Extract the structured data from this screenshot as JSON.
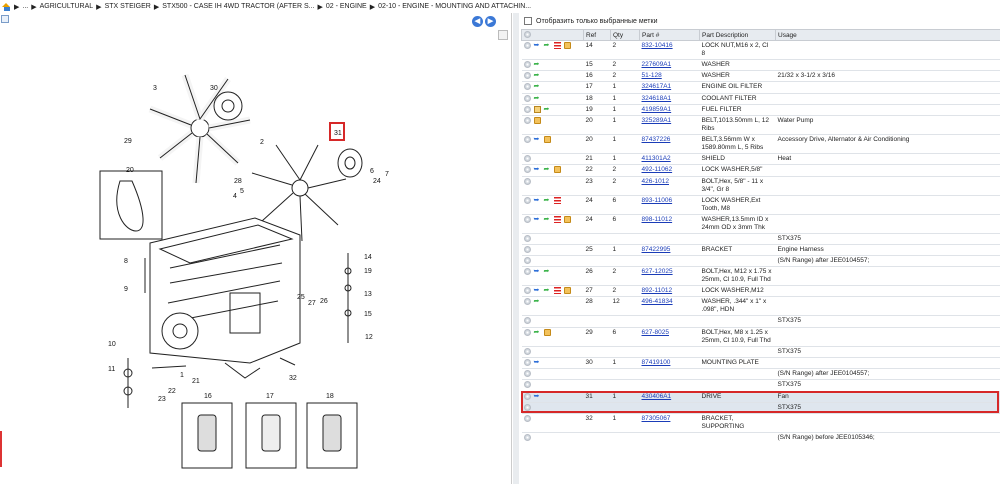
{
  "breadcrumb": {
    "items": [
      "...",
      "AGRICULTURAL",
      "STX STEIGER",
      "STX500 - CASE IH 4WD TRACTOR (AFTER S...",
      "02 - ENGINE",
      "02-10 - ENGINE - MOUNTING AND ATTACHIN..."
    ]
  },
  "filter": {
    "label": "Отобразить только выбранные метки"
  },
  "table": {
    "headers": [
      "Ref",
      "Qty",
      "Part #",
      "Part Description",
      "Usage"
    ],
    "rows": [
      {
        "icons": [
          "cart",
          "arrow",
          "bars",
          "box"
        ],
        "ref": "14",
        "qty": "2",
        "part": "832-10416",
        "desc": "LOCK NUT,M16 x 2, Cl 8",
        "usage": ""
      },
      {
        "icons": [
          "arrow"
        ],
        "ref": "15",
        "qty": "2",
        "part": "227609A1",
        "desc": "WASHER",
        "usage": ""
      },
      {
        "icons": [
          "arrow"
        ],
        "ref": "16",
        "qty": "2",
        "part": "51-128",
        "desc": "WASHER",
        "usage": "21/32 x 3-1/2 x 3/16"
      },
      {
        "icons": [
          "arrow"
        ],
        "ref": "17",
        "qty": "1",
        "part": "324617A1",
        "desc": "ENGINE OIL FILTER",
        "usage": ""
      },
      {
        "icons": [
          "arrow"
        ],
        "ref": "18",
        "qty": "1",
        "part": "324618A1",
        "desc": "COOLANT FILTER",
        "usage": ""
      },
      {
        "icons": [
          "pkg",
          "arrow"
        ],
        "ref": "19",
        "qty": "1",
        "part": "419859A1",
        "desc": "FUEL FILTER",
        "usage": ""
      },
      {
        "icons": [
          "box"
        ],
        "ref": "20",
        "qty": "1",
        "part": "325289A1",
        "desc": "BELT,1013.50mm L, 12 Ribs",
        "usage": "Water Pump"
      },
      {
        "icons": [
          "cart",
          "box"
        ],
        "ref": "20",
        "qty": "1",
        "part": "87437226",
        "desc": "BELT,3.56mm W x 1589.80mm L, 5 Ribs",
        "usage": "Accessory Drive, Alternator & Air Conditioning"
      },
      {
        "icons": [],
        "ref": "21",
        "qty": "1",
        "part": "411301A2",
        "desc": "SHIELD",
        "usage": "Heat"
      },
      {
        "icons": [
          "cart",
          "arrow",
          "box"
        ],
        "ref": "22",
        "qty": "2",
        "part": "492-11062",
        "desc": "LOCK WASHER,5/8\"",
        "usage": ""
      },
      {
        "icons": [],
        "ref": "23",
        "qty": "2",
        "part": "426-1012",
        "desc": "BOLT,Hex, 5/8\" - 11 x 3/4\", Gr 8",
        "usage": ""
      },
      {
        "icons": [
          "cart",
          "arrow",
          "bars"
        ],
        "ref": "24",
        "qty": "6",
        "part": "893-11006",
        "desc": "LOCK WASHER,Ext Tooth, M8",
        "usage": ""
      },
      {
        "icons": [
          "cart",
          "arrow",
          "bars",
          "box"
        ],
        "ref": "24",
        "qty": "6",
        "part": "898-11012",
        "desc": "WASHER,13.5mm ID x 24mm OD x 3mm Thk",
        "usage": ""
      },
      {
        "icons": [],
        "ref": "",
        "qty": "",
        "part": "",
        "desc": "",
        "usage": "STX375"
      },
      {
        "icons": [],
        "ref": "25",
        "qty": "1",
        "part": "87422995",
        "desc": "BRACKET",
        "usage": "Engine Harness"
      },
      {
        "icons": [],
        "ref": "",
        "qty": "",
        "part": "",
        "desc": "",
        "usage": "(S/N Range) after JEE0104557;"
      },
      {
        "icons": [
          "cart",
          "arrow"
        ],
        "ref": "26",
        "qty": "2",
        "part": "627-12025",
        "desc": "BOLT,Hex, M12 x 1.75 x 25mm, Cl 10.9, Full Thd",
        "usage": ""
      },
      {
        "icons": [
          "cart",
          "arrow",
          "bars",
          "box"
        ],
        "ref": "27",
        "qty": "2",
        "part": "892-11012",
        "desc": "LOCK WASHER,M12",
        "usage": ""
      },
      {
        "icons": [
          "arrow"
        ],
        "ref": "28",
        "qty": "12",
        "part": "496-41834",
        "desc": "WASHER, .344\" x 1\" x .098\", HDN",
        "usage": ""
      },
      {
        "icons": [],
        "ref": "",
        "qty": "",
        "part": "",
        "desc": "",
        "usage": "STX375"
      },
      {
        "icons": [
          "arrow",
          "box"
        ],
        "ref": "29",
        "qty": "6",
        "part": "627-8025",
        "desc": "BOLT,Hex, M8 x 1.25 x 25mm, Cl 10.9, Full Thd",
        "usage": ""
      },
      {
        "icons": [],
        "ref": "",
        "qty": "",
        "part": "",
        "desc": "",
        "usage": "STX375"
      },
      {
        "icons": [
          "cart"
        ],
        "ref": "30",
        "qty": "1",
        "part": "87419100",
        "desc": "MOUNTING PLATE",
        "usage": ""
      },
      {
        "icons": [],
        "ref": "",
        "qty": "",
        "part": "",
        "desc": "",
        "usage": "(S/N Range) after JEE0104557;"
      },
      {
        "icons": [],
        "ref": "",
        "qty": "",
        "part": "",
        "desc": "",
        "usage": "STX375"
      },
      {
        "icons": [
          "cart"
        ],
        "ref": "31",
        "qty": "1",
        "part": "430406A1",
        "desc": "DRIVE",
        "usage": "Fan",
        "selected": true
      },
      {
        "icons": [],
        "ref": "",
        "qty": "",
        "part": "",
        "desc": "",
        "usage": "STX375",
        "selected": true
      },
      {
        "icons": [],
        "ref": "32",
        "qty": "1",
        "part": "87305067",
        "desc": "BRACKET, SUPPORTING",
        "usage": ""
      },
      {
        "icons": [],
        "ref": "",
        "qty": "",
        "part": "",
        "desc": "",
        "usage": "(S/N Range) before JEE0105346;"
      }
    ]
  },
  "diagram": {
    "callouts": [
      "1",
      "2",
      "3",
      "4",
      "5",
      "6",
      "7",
      "8",
      "9",
      "10",
      "11",
      "12",
      "13",
      "14",
      "15",
      "16",
      "17",
      "18",
      "19",
      "20",
      "21",
      "22",
      "23",
      "24",
      "25",
      "26",
      "27",
      "28",
      "29",
      "30",
      "31",
      "32"
    ]
  }
}
